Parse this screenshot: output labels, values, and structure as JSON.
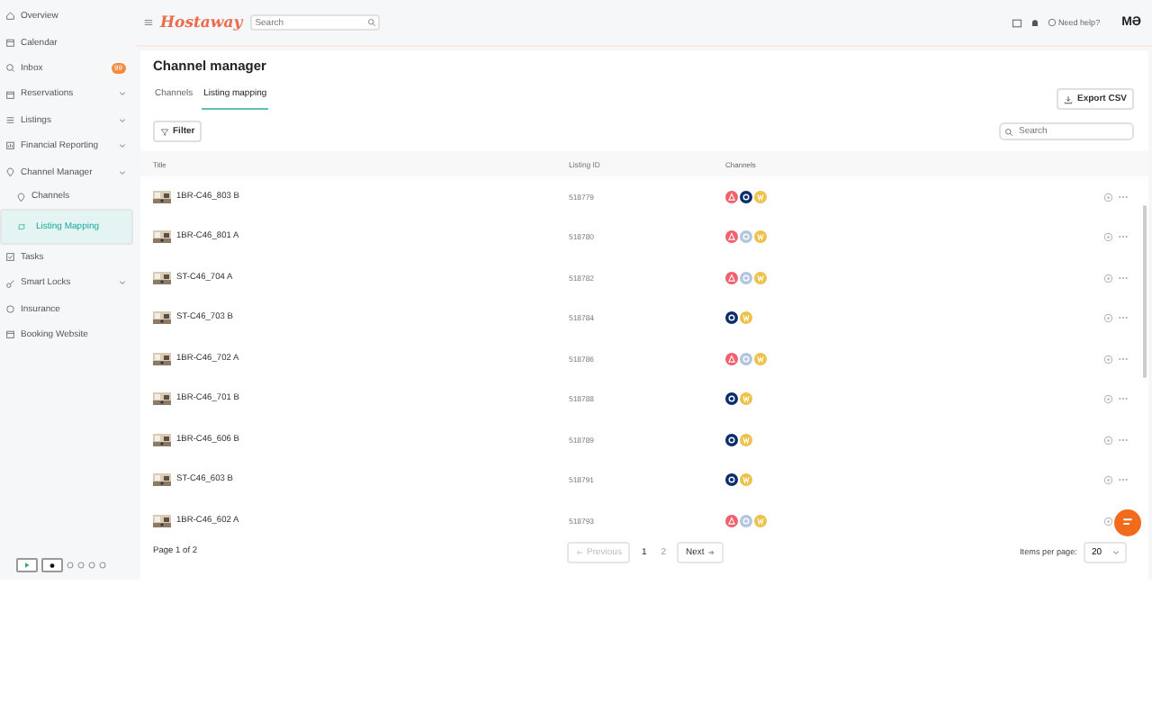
{
  "sidebar": {
    "items": [
      {
        "label": "Overview",
        "selected": false,
        "expandable": false
      },
      {
        "label": "Calendar",
        "selected": false,
        "expandable": false
      },
      {
        "label": "Inbox",
        "selected": false,
        "expandable": false,
        "badge": "99"
      },
      {
        "label": "Reservations",
        "selected": false,
        "expandable": true
      },
      {
        "label": "Listings",
        "selected": false,
        "expandable": true
      },
      {
        "label": "Financial Reporting",
        "selected": false,
        "expandable": true
      },
      {
        "label": "Channel Manager",
        "selected": false,
        "expandable": true,
        "children": [
          {
            "label": "Channels",
            "selected": false
          },
          {
            "label": "Listing Mapping",
            "selected": true
          }
        ]
      },
      {
        "label": "Tasks",
        "selected": false,
        "expandable": false
      },
      {
        "label": "Smart Locks",
        "selected": false,
        "expandable": true
      },
      {
        "label": "Insurance",
        "selected": false,
        "expandable": false
      },
      {
        "label": "Booking Website",
        "selected": false,
        "expandable": false
      }
    ]
  },
  "header": {
    "logo": "Hostaway",
    "search": {
      "placeholder": "Search"
    },
    "help": "Need help?",
    "avatar": "MƏ"
  },
  "page": {
    "title": "Channel manager",
    "tabs": [
      {
        "label": "Channels",
        "selected": false
      },
      {
        "label": "Listing mapping",
        "selected": true
      }
    ],
    "export_button": "Export CSV",
    "filter_button": "Filter",
    "search": {
      "placeholder": "Search"
    }
  },
  "table": {
    "columns": [
      "Title",
      "Listing ID",
      "Channels"
    ],
    "rows": [
      {
        "title": "1BR-C46_803 B",
        "listing_id": "518779",
        "channels": [
          {
            "kind": "airbnb",
            "active": true
          },
          {
            "kind": "booking",
            "active": true
          },
          {
            "kind": "vrbo",
            "active": true
          }
        ]
      },
      {
        "title": "1BR-C46_801 A",
        "listing_id": "518780",
        "channels": [
          {
            "kind": "airbnb",
            "active": true
          },
          {
            "kind": "booking",
            "active": false
          },
          {
            "kind": "vrbo",
            "active": true
          }
        ]
      },
      {
        "title": "ST-C46_704 A",
        "listing_id": "518782",
        "channels": [
          {
            "kind": "airbnb",
            "active": true
          },
          {
            "kind": "booking",
            "active": false
          },
          {
            "kind": "vrbo",
            "active": true
          }
        ]
      },
      {
        "title": "ST-C46_703 B",
        "listing_id": "518784",
        "channels": [
          {
            "kind": "booking",
            "active": true
          },
          {
            "kind": "vrbo",
            "active": true
          }
        ]
      },
      {
        "title": "1BR-C46_702 A",
        "listing_id": "518786",
        "channels": [
          {
            "kind": "airbnb",
            "active": true
          },
          {
            "kind": "booking",
            "active": false
          },
          {
            "kind": "vrbo",
            "active": true
          }
        ]
      },
      {
        "title": "1BR-C46_701 B",
        "listing_id": "518788",
        "channels": [
          {
            "kind": "booking",
            "active": true
          },
          {
            "kind": "vrbo",
            "active": true
          }
        ]
      },
      {
        "title": "1BR-C46_606 B",
        "listing_id": "518789",
        "channels": [
          {
            "kind": "booking",
            "active": true
          },
          {
            "kind": "vrbo",
            "active": true
          }
        ]
      },
      {
        "title": "ST-C46_603 B",
        "listing_id": "518791",
        "channels": [
          {
            "kind": "booking",
            "active": true
          },
          {
            "kind": "vrbo",
            "active": true
          }
        ]
      },
      {
        "title": "1BR-C46_602 A",
        "listing_id": "518793",
        "channels": [
          {
            "kind": "airbnb",
            "active": true
          },
          {
            "kind": "booking",
            "active": false
          },
          {
            "kind": "vrbo",
            "active": true
          }
        ]
      }
    ]
  },
  "pagination": {
    "summary": "Page 1 of 2",
    "previous": "Previous",
    "next": "Next",
    "pages": [
      {
        "label": "1",
        "selected": true
      },
      {
        "label": "2",
        "selected": false
      }
    ],
    "per_page_label": "Items per page:",
    "per_page": "20"
  }
}
